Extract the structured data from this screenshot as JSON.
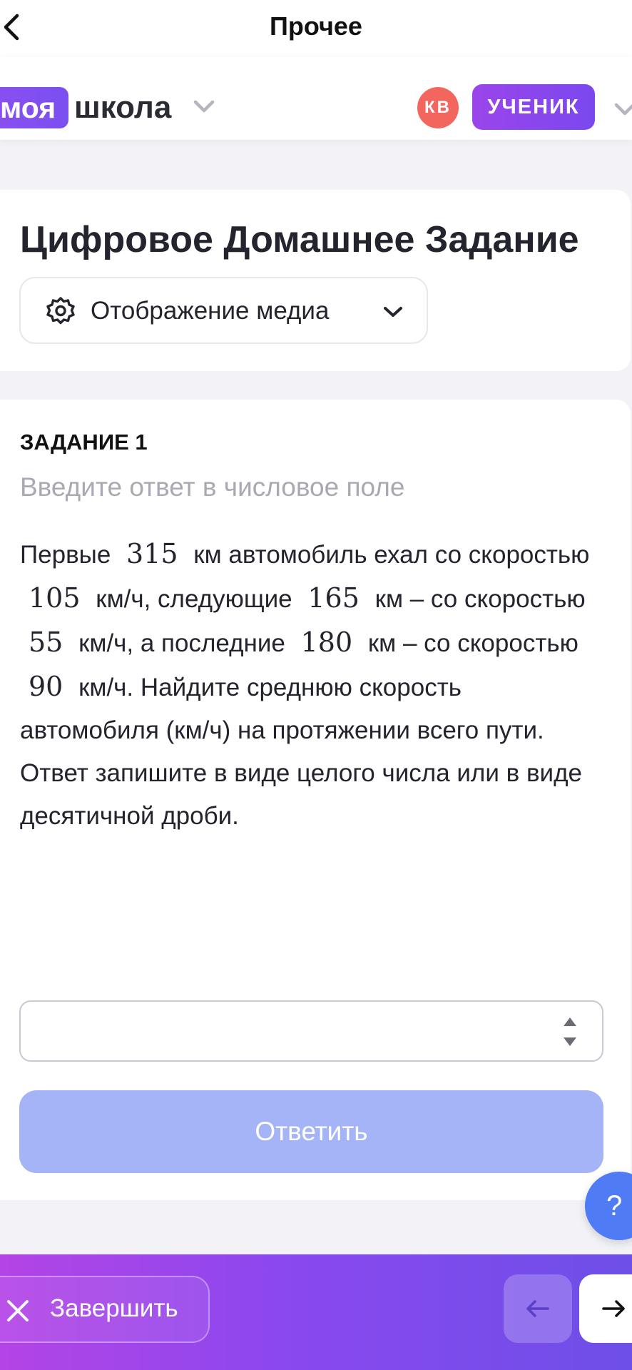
{
  "nav": {
    "title": "Прочее",
    "back_icon": "chevron-left-icon"
  },
  "header": {
    "logo_badge": "моя",
    "logo_text": "школа",
    "avatar_initials": "КВ",
    "role": "УЧЕНИК",
    "colors": {
      "brand": "#8a4ff0",
      "avatar": "#f2665e"
    }
  },
  "main": {
    "title": "Цифровое Домашнее Задание",
    "media_dropdown": {
      "label": "Отображение медиа",
      "icon": "gear-icon"
    }
  },
  "task": {
    "heading": "ЗАДАНИЕ 1",
    "hint": "Введите ответ в числовое поле",
    "parts": [
      "Первые ",
      "315",
      " км автомобиль ехал со скоростью ",
      "105",
      " км/ч, следующие ",
      "165",
      " км – со скоростью ",
      "55",
      " км/ч, а последние ",
      "180",
      " км – со скоростью ",
      "90",
      " км/ч. Найдите среднюю скорость автомобиля (км/ч) на протяжении всего пути. Ответ запишите в виде целого числа или в виде десятичной дроби."
    ],
    "answer_value": "",
    "submit_label": "Ответить",
    "submit_color": "#a4b4f6"
  },
  "help": {
    "label": "?"
  },
  "footer": {
    "finish_label": "Завершить",
    "prev_icon": "arrow-left-icon",
    "next_icon": "arrow-right-icon"
  }
}
